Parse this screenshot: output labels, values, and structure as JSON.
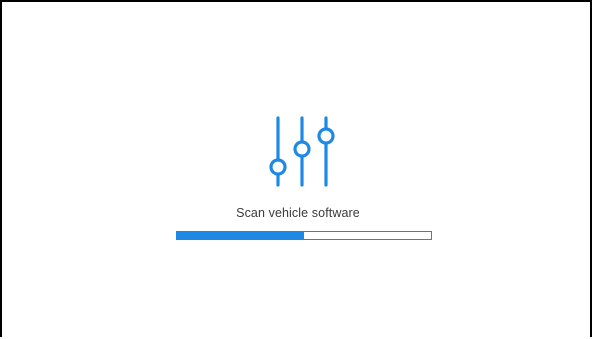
{
  "screen": {
    "icon": "sliders-adjust-icon",
    "status_text": "Scan vehicle software",
    "progress": 0.5,
    "accent_color": "#1e88e5"
  }
}
